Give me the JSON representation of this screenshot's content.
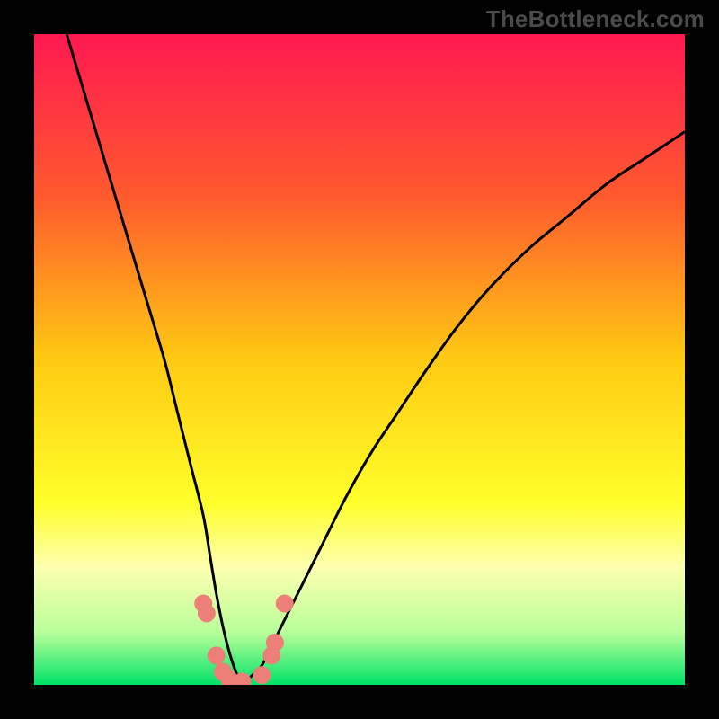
{
  "watermark": "TheBottleneck.com",
  "chart_data": {
    "type": "line",
    "title": "",
    "xlabel": "",
    "ylabel": "",
    "xlim": [
      0,
      100
    ],
    "ylim": [
      0,
      100
    ],
    "grid": false,
    "legend": false,
    "background_gradient": {
      "stops": [
        {
          "offset": 0.0,
          "color": "#ff1850"
        },
        {
          "offset": 0.25,
          "color": "#ff5a2e"
        },
        {
          "offset": 0.5,
          "color": "#ffca12"
        },
        {
          "offset": 0.72,
          "color": "#ffff2a"
        },
        {
          "offset": 0.82,
          "color": "#fdffb0"
        },
        {
          "offset": 0.92,
          "color": "#b8ff9a"
        },
        {
          "offset": 1.0,
          "color": "#00e267"
        }
      ]
    },
    "series": [
      {
        "name": "bottleneck-curve",
        "color": "#000000",
        "x": [
          5,
          8,
          11,
          14,
          17,
          20,
          22,
          24,
          26,
          27,
          28,
          29,
          30,
          31,
          32,
          33,
          35,
          37,
          40,
          44,
          48,
          52,
          56,
          60,
          65,
          70,
          76,
          82,
          88,
          94,
          100
        ],
        "y": [
          100,
          90,
          80,
          70,
          60,
          50,
          42,
          34,
          26,
          20,
          14,
          9,
          5,
          2,
          0,
          1,
          3,
          7,
          13,
          21,
          29,
          36,
          42,
          48,
          55,
          61,
          67,
          72,
          77,
          81,
          85
        ]
      }
    ],
    "markers": {
      "name": "highlight-points",
      "color": "#ec8079",
      "points": [
        {
          "x": 26.0,
          "y": 12.5
        },
        {
          "x": 26.5,
          "y": 11.0
        },
        {
          "x": 28.0,
          "y": 4.5
        },
        {
          "x": 29.0,
          "y": 2.0
        },
        {
          "x": 30.0,
          "y": 0.8
        },
        {
          "x": 32.0,
          "y": 0.5
        },
        {
          "x": 35.0,
          "y": 1.5
        },
        {
          "x": 36.5,
          "y": 4.5
        },
        {
          "x": 37.0,
          "y": 6.5
        },
        {
          "x": 38.5,
          "y": 12.5
        }
      ],
      "radius": 10
    }
  }
}
